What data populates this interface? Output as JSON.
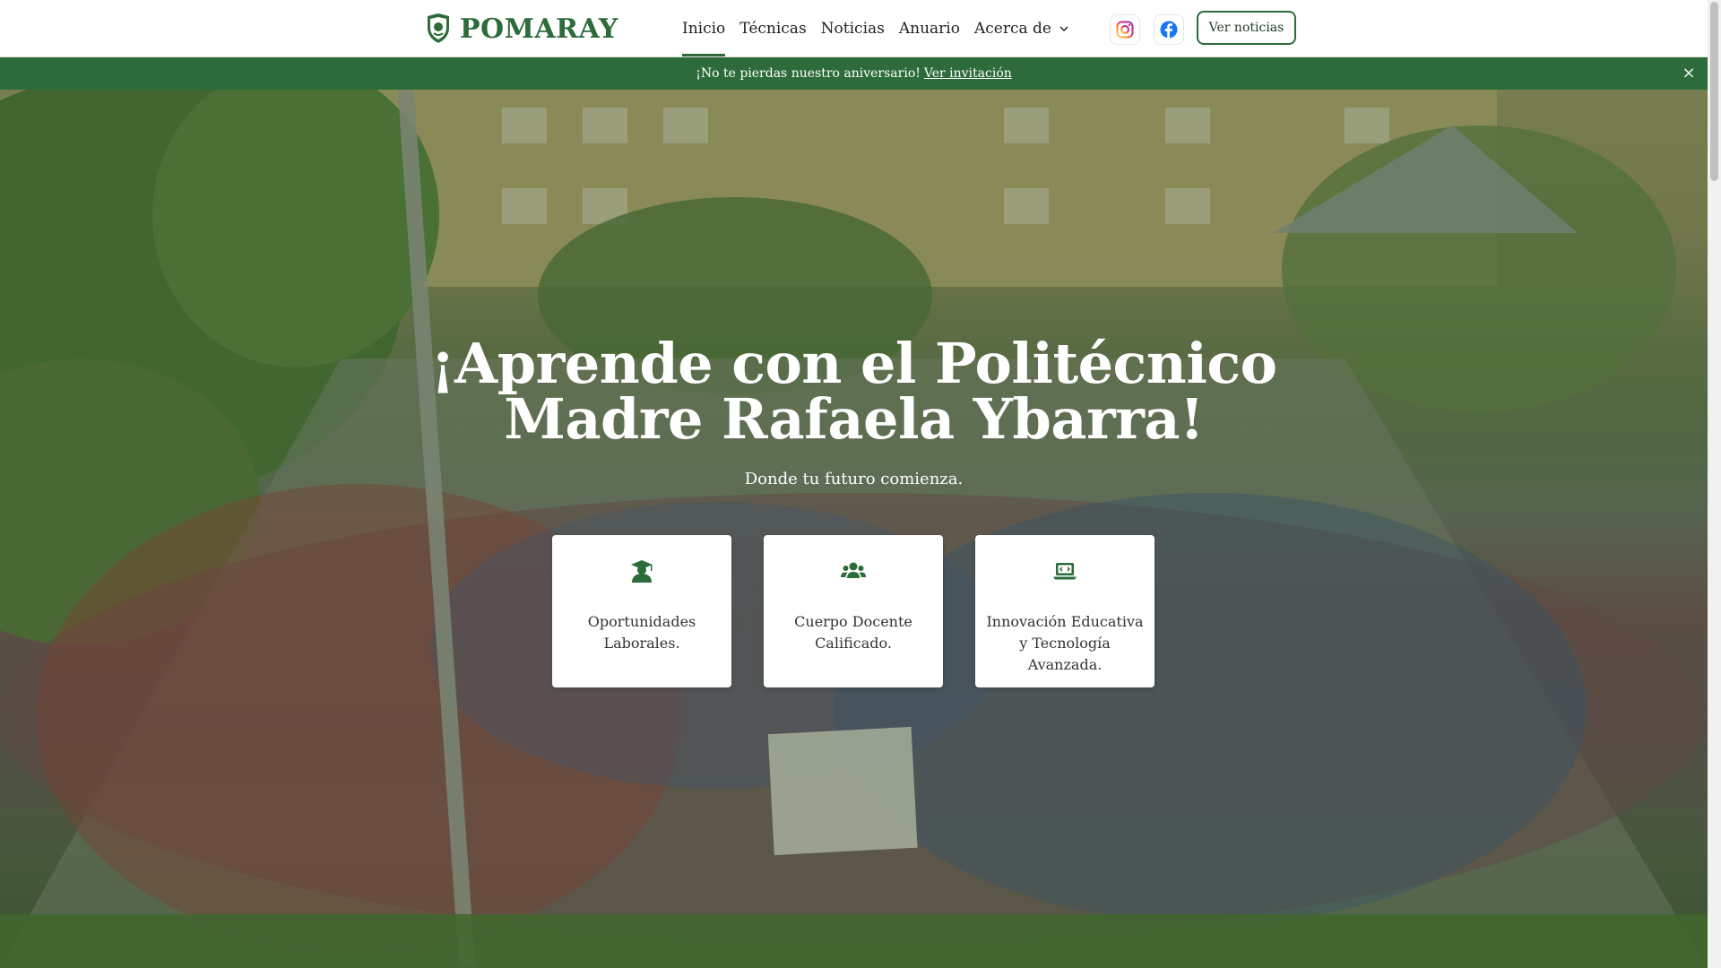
{
  "header": {
    "brand": "POMARAY",
    "nav": [
      {
        "label": "Inicio",
        "active": true
      },
      {
        "label": "Técnicas",
        "active": false
      },
      {
        "label": "Noticias",
        "active": false
      },
      {
        "label": "Anuario",
        "active": false
      },
      {
        "label": "Acerca de",
        "active": false,
        "has_dropdown": true
      }
    ],
    "social": [
      {
        "name": "instagram-icon"
      },
      {
        "name": "facebook-icon"
      }
    ],
    "cta_label": "Ver noticias",
    "colors": {
      "brand_green": "#2d6b3a",
      "instagram": "#e1306c",
      "facebook": "#1877f2"
    }
  },
  "announcement": {
    "text": "¡No te pierdas nuestro aniversario!",
    "link_label": "Ver invitación",
    "close_symbol": "×"
  },
  "hero": {
    "title": "¡Aprende con el Politécnico Madre Rafaela Ybarra!",
    "subtitle": "Donde tu futuro comienza.",
    "cards": [
      {
        "icon": "graduate-icon",
        "label": "Oportunidades Laborales."
      },
      {
        "icon": "users-icon",
        "label": "Cuerpo Docente Calificado."
      },
      {
        "icon": "laptop-code-icon",
        "label": "Innovación Educativa y Tecnología Avanzada."
      }
    ]
  }
}
